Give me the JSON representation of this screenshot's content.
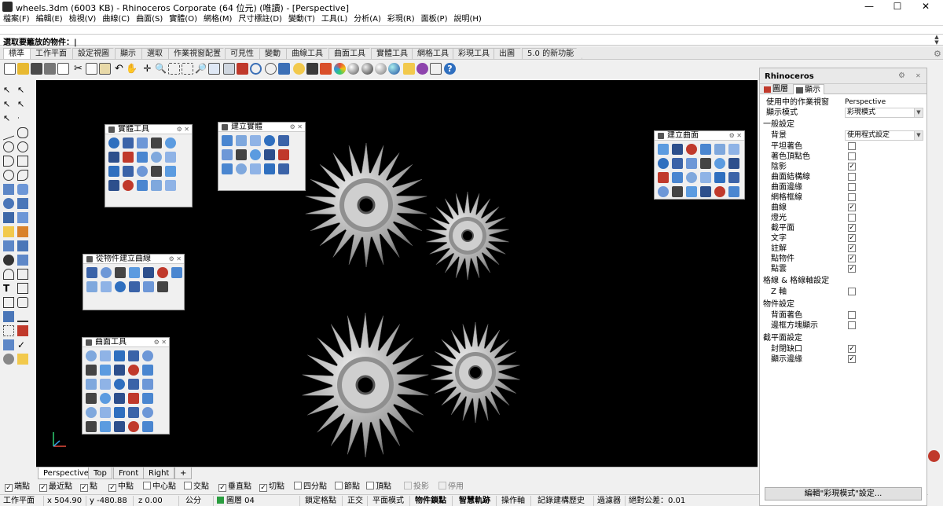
{
  "window": {
    "title": "wheels.3dm (6003 KB) - Rhinoceros Corporate (64 位元) (唯讀) - [Perspective]",
    "min": "—",
    "max": "☐",
    "close": "✕"
  },
  "menu": [
    "檔案(F)",
    "編輯(E)",
    "檢視(V)",
    "曲線(C)",
    "曲面(S)",
    "實體(O)",
    "網格(M)",
    "尺寸標註(D)",
    "變動(T)",
    "工具(L)",
    "分析(A)",
    "彩現(R)",
    "面板(P)",
    "說明(H)"
  ],
  "command": {
    "prompt": "選取要籬放的物件：|"
  },
  "tabs": [
    "標準",
    "工作平面",
    "設定視圖",
    "顯示",
    "選取",
    "作業視窗配置",
    "可見性",
    "變動",
    "曲線工具",
    "曲面工具",
    "實體工具",
    "網格工具",
    "彩現工具",
    "出圖",
    "5.0 的新功能"
  ],
  "palettes": {
    "solid_tools": "實體工具",
    "create_solid": "建立實體",
    "create_surface": "建立曲面",
    "curve_from_objects": "從物件建立曲線",
    "surface_tools": "曲面工具"
  },
  "viewport_tabs": [
    "Perspective",
    "Top",
    "Front",
    "Right",
    "+"
  ],
  "osnaps": [
    {
      "label": "端點",
      "on": true
    },
    {
      "label": "最近點",
      "on": true
    },
    {
      "label": "點",
      "on": true
    },
    {
      "label": "中點",
      "on": true
    },
    {
      "label": "中心點",
      "on": false
    },
    {
      "label": "交點",
      "on": false
    },
    {
      "label": "垂直點",
      "on": true
    },
    {
      "label": "切點",
      "on": true
    },
    {
      "label": "四分點",
      "on": false
    },
    {
      "label": "節點",
      "on": false
    },
    {
      "label": "頂點",
      "on": false
    },
    {
      "label": "投影",
      "on": false,
      "disabled": true
    },
    {
      "label": "停用",
      "on": false,
      "disabled": true
    }
  ],
  "status": {
    "cplane": "工作平面",
    "x": "x 504.90",
    "y": "y -480.88",
    "z": "z 0.00",
    "units": "公分",
    "layer": "圖層 04",
    "lock": "鎖定格點",
    "ortho": "正交",
    "planar": "平面模式",
    "osnap": "物件鎖點",
    "smarttrack": "智慧軌跡",
    "gumball": "操作軸",
    "history": "記錄建構歷史",
    "filter": "過濾器",
    "tolerance": "絕對公差：0.01"
  },
  "panel": {
    "title": "Rhinoceros",
    "tab_layers": "圖層",
    "tab_display": "顯示",
    "active_viewport_label": "使用中的作業視窗",
    "active_viewport_value": "Perspective",
    "display_mode_label": "顯示模式",
    "display_mode_value": "彩現模式",
    "general": "一般設定",
    "background_label": "背景",
    "background_value": "使用程式設定",
    "rows_general": [
      {
        "label": "平坦著色",
        "on": false
      },
      {
        "label": "著色頂點色",
        "on": false
      },
      {
        "label": "陰影",
        "on": true
      },
      {
        "label": "曲面結構線",
        "on": false
      },
      {
        "label": "曲面邊緣",
        "on": false
      },
      {
        "label": "網格框線",
        "on": false
      },
      {
        "label": "曲線",
        "on": true
      },
      {
        "label": "燈光",
        "on": false
      },
      {
        "label": "截平面",
        "on": true
      },
      {
        "label": "文字",
        "on": true
      },
      {
        "label": "註解",
        "on": true
      },
      {
        "label": "點物件",
        "on": true
      },
      {
        "label": "點雲",
        "on": true
      }
    ],
    "grid_section": "格線 & 格線軸設定",
    "rows_grid": [
      {
        "label": "Z 軸",
        "on": false
      }
    ],
    "object_section": "物件設定",
    "rows_object": [
      {
        "label": "背面著色",
        "on": false
      },
      {
        "label": "邊框方塊顯示",
        "on": false
      }
    ],
    "clip_section": "截平面設定",
    "rows_clip": [
      {
        "label": "封閉缺口",
        "on": true
      },
      {
        "label": "顯示邊緣",
        "on": true
      }
    ],
    "edit_button": "編輯\"彩現模式\"設定..."
  },
  "check_glyph": "✓",
  "colors": {
    "accent": "#1e6fd9",
    "icon_blue": "#2f6fbf",
    "gear_light": "#e4e4e4",
    "gear_dark": "#5a5a5a",
    "layer_green": "#2a9d3f"
  }
}
